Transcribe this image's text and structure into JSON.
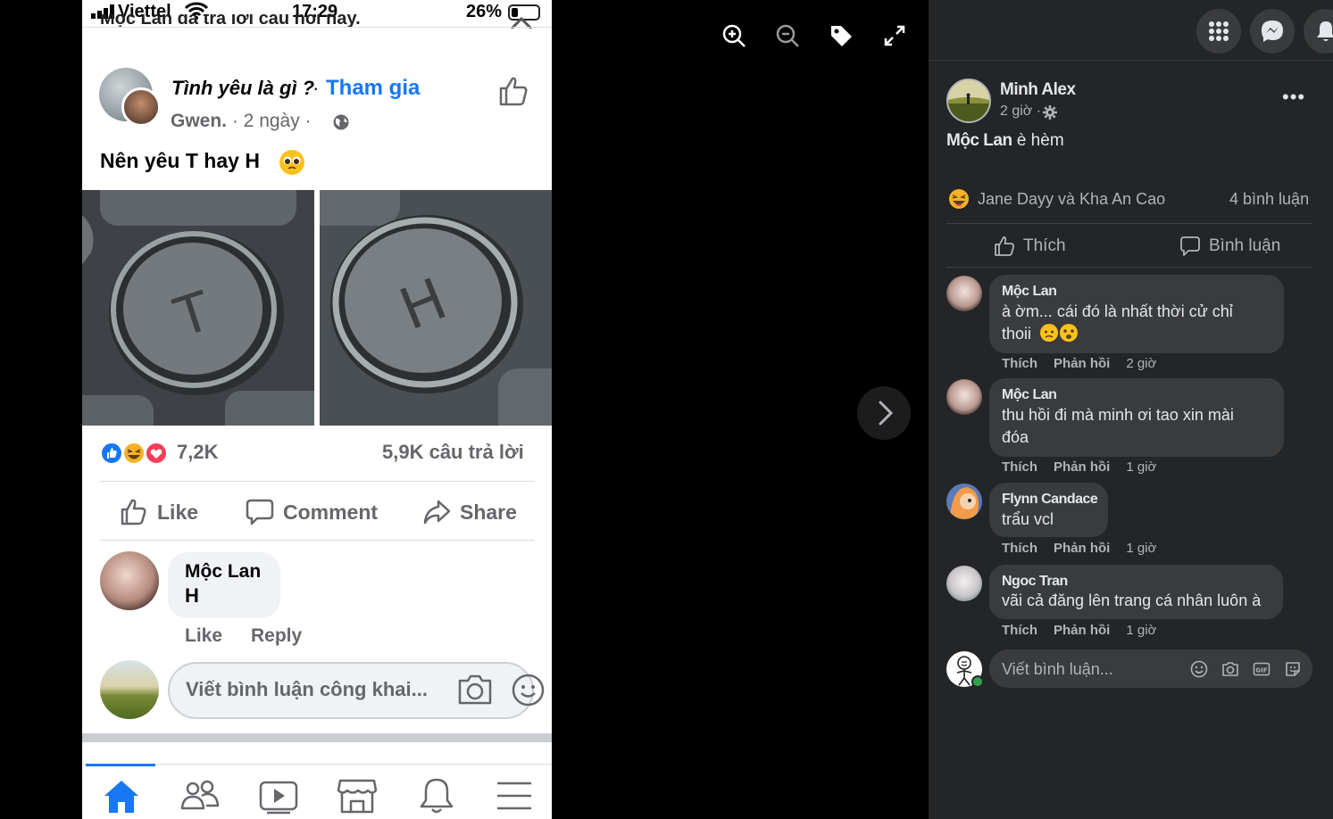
{
  "phone": {
    "status": {
      "carrier": "Viettel",
      "time": "17:29",
      "battery": "26%"
    },
    "clipped_header": "Mộc Lan đã trả lời câu hỏi này.",
    "post": {
      "group_name": "Tình yêu là gì ?",
      "separator": "·",
      "join_label": "Tham gia",
      "author": "Gwen.",
      "age": " · 2 ngày · ",
      "text": "Nên yêu T hay H",
      "image_left_letter": "T",
      "image_right_letter": "H",
      "reaction_count": "7,2K",
      "answers_count": "5,9K câu trả lời"
    },
    "actions": {
      "like": "Like",
      "comment": "Comment",
      "share": "Share"
    },
    "comment": {
      "name": "Mộc Lan",
      "text": "H",
      "like": "Like",
      "reply": "Reply"
    },
    "composer_placeholder": "Viết bình luận công khai..."
  },
  "panel": {
    "author": "Minh Alex",
    "time": "2 giờ ·",
    "caption_name": "Mộc Lan",
    "caption_rest": " è hèm",
    "reactors": "Jane Dayy và Kha An Cao",
    "comment_count": "4 bình luận",
    "like_label": "Thích",
    "comment_label": "Bình luận",
    "comments": [
      {
        "name": "Mộc Lan",
        "line1": "à ờm... cái đó là nhất thời cử chỉ",
        "line2": "thoii",
        "like": "Thích",
        "reply": "Phản hồi",
        "time": "2 giờ"
      },
      {
        "name": "Mộc Lan",
        "line1": "thu hồi đi mà minh ơi tao xin mài",
        "line2": "đóa",
        "like": "Thích",
        "reply": "Phản hồi",
        "time": "1 giờ"
      },
      {
        "name": "Flynn Candace",
        "line1": "trẩu vcl",
        "like": "Thích",
        "reply": "Phản hồi",
        "time": "1 giờ"
      },
      {
        "name": "Ngoc Tran",
        "line1": "vãi cả đăng lên trang cá nhân luôn à",
        "like": "Thích",
        "reply": "Phản hồi",
        "time": "1 giờ"
      }
    ],
    "write_placeholder": "Viết bình luận...",
    "gif_label": "GIF"
  },
  "colors": {
    "facebook_blue": "#1877f2",
    "dark_panel": "#242526",
    "bubble_dark": "#3a3b3c",
    "online_green": "#31a24c"
  }
}
